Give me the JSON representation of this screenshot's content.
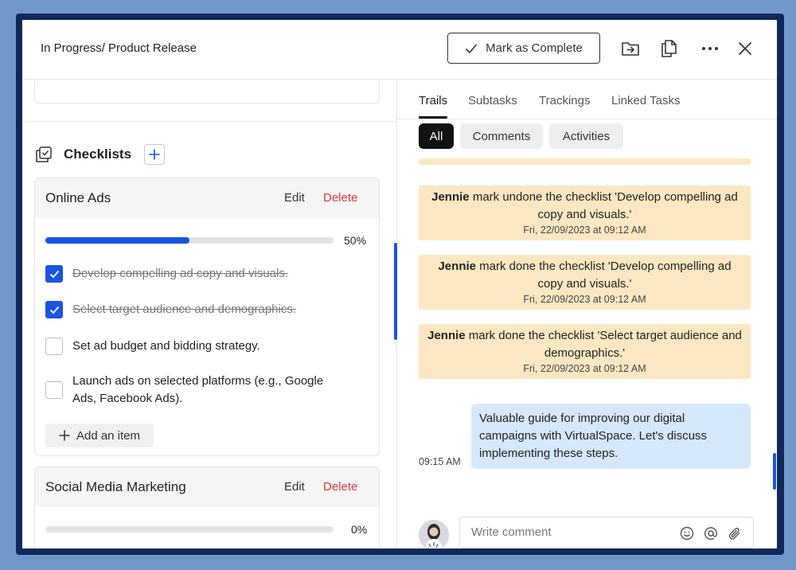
{
  "header": {
    "breadcrumb": "In Progress/ Product Release",
    "complete_label": "Mark as Complete"
  },
  "checklists": {
    "title": "Checklists",
    "add_item_label": "Add an item",
    "edit_label": "Edit",
    "delete_label": "Delete",
    "lists": [
      {
        "name": "Online Ads",
        "progress": 0.5,
        "progress_label": "50%",
        "items": [
          {
            "text": "Develop compelling ad copy and visuals.",
            "done": true
          },
          {
            "text": "Select target audience and demographics.",
            "done": true
          },
          {
            "text": "Set ad budget and bidding strategy.",
            "done": false
          },
          {
            "text": "Launch ads on selected platforms (e.g., Google Ads, Facebook Ads).",
            "done": false
          }
        ]
      },
      {
        "name": "Social Media Marketing",
        "progress": 0,
        "progress_label": "0%"
      }
    ]
  },
  "tabs": [
    "Trails",
    "Subtasks",
    "Trackings",
    "Linked Tasks"
  ],
  "filters": [
    "All",
    "Comments",
    "Activities"
  ],
  "activities": [
    {
      "user": "Jennie",
      "text": " mark undone the checklist 'Develop compelling ad copy and visuals.'",
      "time": "Fri, 22/09/2023 at 09:12 AM"
    },
    {
      "user": "Jennie",
      "text": " mark done the checklist 'Develop compelling ad copy and visuals.'",
      "time": "Fri, 22/09/2023 at 09:12 AM"
    },
    {
      "user": "Jennie",
      "text": " mark done the checklist 'Select target audience and demographics.'",
      "time": "Fri, 22/09/2023 at 09:12 AM"
    }
  ],
  "comment": {
    "text": "Valuable guide for improving our digital campaigns with VirtualSpace. Let's discuss implementing these steps.",
    "time": "09:15 AM"
  },
  "composer": {
    "placeholder": "Write comment"
  },
  "colors": {
    "accent": "#1a54e0",
    "delete": "#e0393e",
    "activity_bg": "#fbe8c2",
    "comment_bg": "#d6e8fb"
  }
}
